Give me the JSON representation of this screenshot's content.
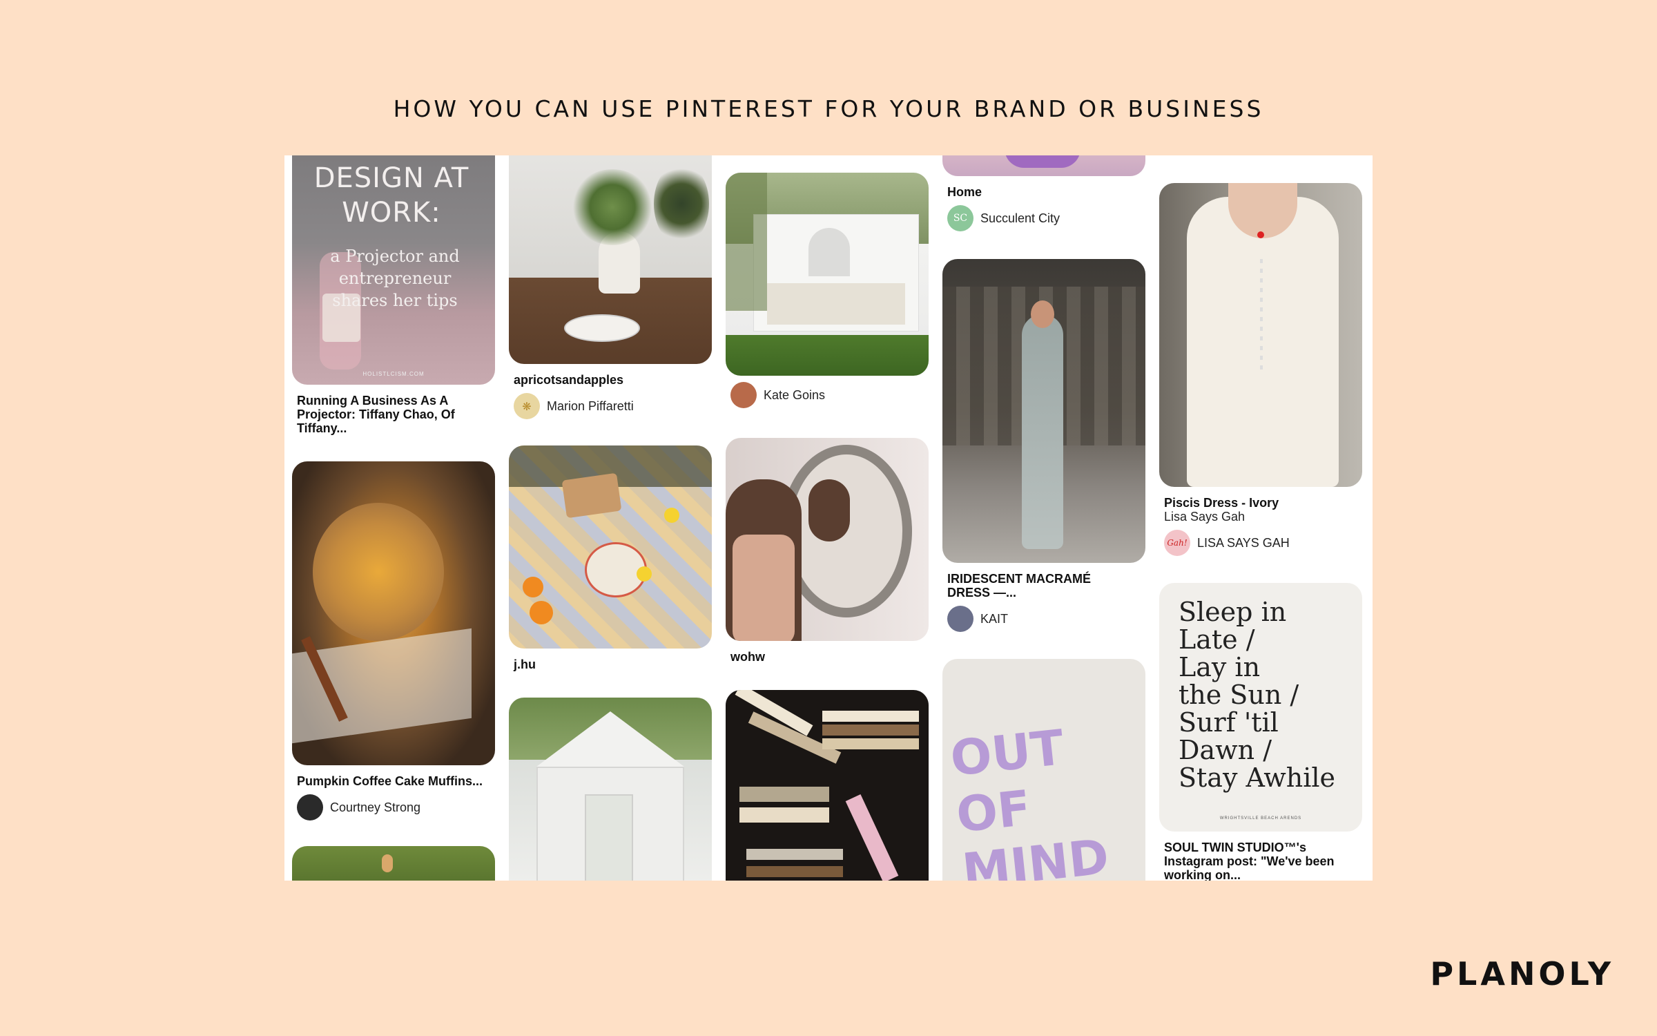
{
  "headline": "HOW YOU CAN USE PINTEREST FOR YOUR BRAND OR BUSINESS",
  "brand": "PLANOLY",
  "pins": {
    "design_at_work": {
      "overlay_title": "DESIGN AT WORK:",
      "overlay_body": "a Projector and entrepreneur shares her tips",
      "overlay_site": "HOLISTLCISM.COM",
      "title": "Running A Business As A Projector: Tiffany Chao, Of Tiffany..."
    },
    "muffins": {
      "title": "Pumpkin Coffee Cake Muffins...",
      "author": "Courtney Strong"
    },
    "table": {
      "title": "apricotsandapples",
      "author": "Marion Piffaretti"
    },
    "picnic": {
      "title": "j.hu"
    },
    "white_house": {
      "author": "Kate Goins"
    },
    "mirror": {
      "title": "wohw"
    },
    "home": {
      "title": "Home",
      "author": "Succulent City",
      "avatar_text": "SC"
    },
    "dress": {
      "title": "IRIDESCENT MACRAMÉ DRESS —...",
      "author": "KAIT"
    },
    "out_of_mind": {
      "art_text": "OUT OF MIND"
    },
    "piscis": {
      "title": "Piscis Dress - Ivory",
      "subtitle": "Lisa Says Gah",
      "author": "LISA SAYS GAH",
      "avatar_text": "Gah!"
    },
    "sleep_in": {
      "poem": [
        "Sleep in",
        "Late /",
        "Lay in",
        "the Sun /",
        "Surf 'til",
        "Dawn /",
        "Stay Awhile"
      ],
      "footer": "WRIGHTSVILLE BEACH ARENDS",
      "title": "SOUL TWIN STUDIO™'s Instagram post: \"We've been working on..."
    }
  }
}
